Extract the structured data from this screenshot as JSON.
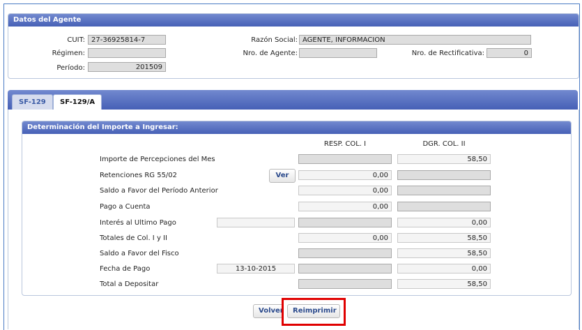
{
  "agent": {
    "title": "Datos del Agente",
    "cuit_label": "CUIT:",
    "cuit": "27-36925814-7",
    "razon_label": "Razón Social:",
    "razon": "AGENTE, INFORMACION",
    "regimen_label": "Régimen:",
    "regimen": "",
    "nro_agente_label": "Nro. de Agente:",
    "nro_agente": "",
    "nro_rect_label": "Nro. de Rectificativa:",
    "nro_rect": "0",
    "periodo_label": "Período:",
    "periodo": "201509"
  },
  "tabs": [
    {
      "label": "SF-129",
      "active": false
    },
    {
      "label": "SF-129/A",
      "active": true
    }
  ],
  "section": {
    "title": "Determinación del Importe a Ingresar:",
    "col1": "RESP. COL. I",
    "col2": "DGR. COL. II"
  },
  "rows": [
    {
      "label": "Importe de Percepciones del Mes",
      "extra": "",
      "c1": "",
      "c2": "58,50"
    },
    {
      "label": "Retenciones RG 55/02",
      "extra": "",
      "c1": "0,00",
      "c2": ""
    },
    {
      "label": "Saldo a Favor del Período Anterior",
      "extra": "",
      "c1": "0,00",
      "c2": ""
    },
    {
      "label": "Pago a Cuenta",
      "extra": "",
      "c1": "0,00",
      "c2": ""
    },
    {
      "label": "Interés al Ultimo Pago",
      "extra": "",
      "c1": "",
      "c2": "0,00"
    },
    {
      "label": "Totales de Col. I y II",
      "extra": "",
      "c1": "0,00",
      "c2": "58,50"
    },
    {
      "label": "Saldo a Favor del Fisco",
      "extra": "",
      "c1": "",
      "c2": "58,50"
    },
    {
      "label": "Fecha de Pago",
      "extra": "13-10-2015",
      "c1": "",
      "c2": "0,00"
    },
    {
      "label": "Total a Depositar",
      "extra": "",
      "c1": "",
      "c2": "58,50"
    }
  ],
  "buttons": {
    "ver": "Ver",
    "volver": "Volver",
    "reimprimir": "Reimprimir"
  }
}
